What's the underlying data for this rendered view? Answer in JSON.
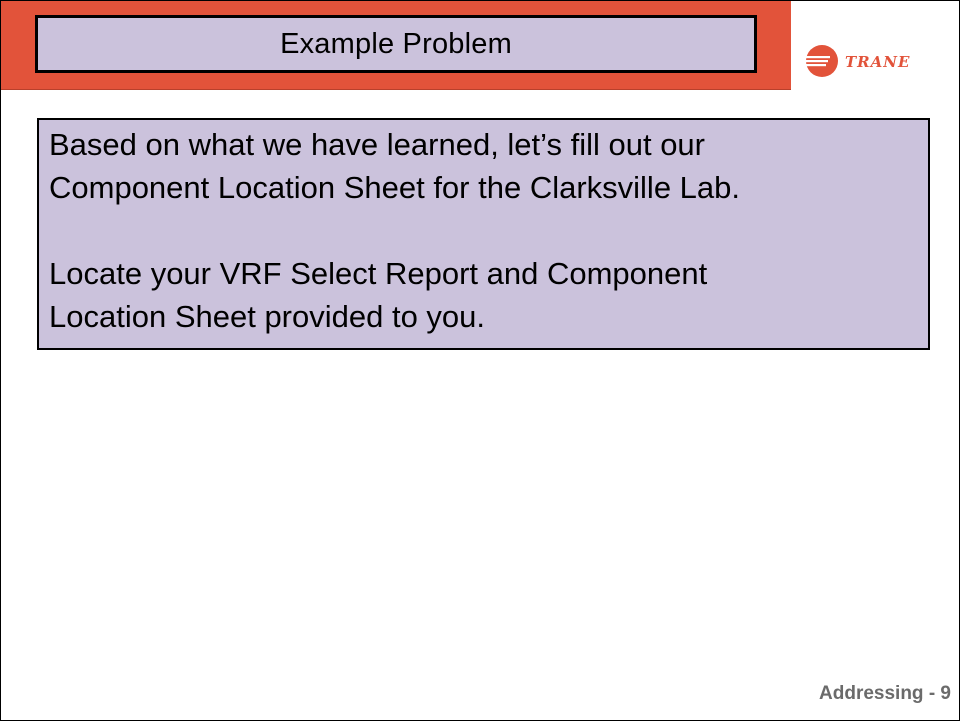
{
  "slide": {
    "title": "Example Problem",
    "body": [
      "Based on what we have learned, let’s fill out our\nComponent Location Sheet for the Clarksville Lab.",
      "Locate your VRF Select Report and Component\nLocation Sheet provided to you."
    ],
    "footer": "Addressing - 9"
  },
  "brand": {
    "logo_text": "TRANE",
    "logo_icon": "trane-logo-icon",
    "accent_color": "#e2533a",
    "box_color": "#cbc2dc",
    "footer_color": "#6b6b6b"
  }
}
